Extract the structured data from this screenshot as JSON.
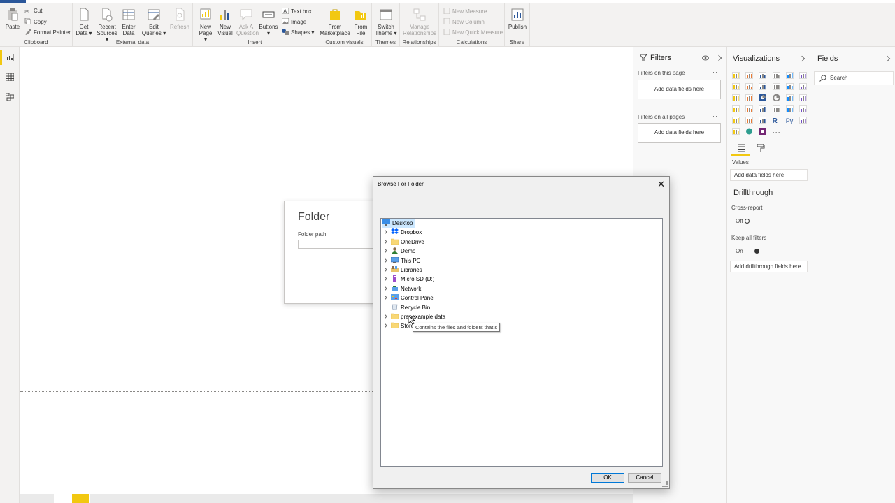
{
  "ribbon": {
    "clipboard": {
      "label": "Clipboard",
      "paste": "Paste",
      "cut": "Cut",
      "copy": "Copy",
      "format_painter": "Format Painter"
    },
    "external_data": {
      "label": "External data",
      "get_data": "Get Data",
      "recent_sources": "Recent Sources",
      "enter_data": "Enter Data",
      "edit_queries": "Edit Queries",
      "refresh": "Refresh"
    },
    "insert": {
      "label": "Insert",
      "new_page": "New Page",
      "new_visual": "New Visual",
      "ask_question": "Ask A Question",
      "buttons": "Buttons",
      "text_box": "Text box",
      "image": "Image",
      "shapes": "Shapes"
    },
    "custom_visuals": {
      "label": "Custom visuals",
      "from_marketplace": "From Marketplace",
      "from_file": "From File"
    },
    "themes": {
      "label": "Themes",
      "switch_theme": "Switch Theme"
    },
    "relationships": {
      "label": "Relationships",
      "manage": "Manage Relationships"
    },
    "calculations": {
      "label": "Calculations",
      "new_measure": "New Measure",
      "new_column": "New Column",
      "new_quick_measure": "New Quick Measure"
    },
    "share": {
      "label": "Share",
      "publish": "Publish"
    }
  },
  "folder_dialog": {
    "title": "Folder",
    "path_label": "Folder path"
  },
  "filters": {
    "title": "Filters",
    "on_this_page": "Filters on this page",
    "on_all_pages": "Filters on all pages",
    "drop_hint": "Add data fields here"
  },
  "visualizations": {
    "title": "Visualizations",
    "values_label": "Values",
    "values_hint": "Add data fields here",
    "drillthrough_title": "Drillthrough",
    "cross_report": "Cross-report",
    "cross_report_state": "Off",
    "keep_all_filters": "Keep all filters",
    "keep_all_filters_state": "On",
    "drillthrough_hint": "Add drillthrough fields here",
    "r_label": "R",
    "py_label": "Py"
  },
  "fields": {
    "title": "Fields",
    "search_placeholder": "Search"
  },
  "browse_dialog": {
    "title": "Browse For Folder",
    "tree": [
      {
        "label": "Desktop",
        "icon": "desktop-icon",
        "expandable": false,
        "selected": true
      },
      {
        "label": "Dropbox",
        "icon": "dropbox-icon",
        "expandable": true
      },
      {
        "label": "OneDrive",
        "icon": "folder-icon",
        "expandable": true
      },
      {
        "label": "Demo",
        "icon": "user-icon",
        "expandable": true
      },
      {
        "label": "This PC",
        "icon": "computer-icon",
        "expandable": true
      },
      {
        "label": "Libraries",
        "icon": "libraries-icon",
        "expandable": true
      },
      {
        "label": "Micro SD (D:)",
        "icon": "usb-drive-icon",
        "expandable": true
      },
      {
        "label": "Network",
        "icon": "network-icon",
        "expandable": true
      },
      {
        "label": "Control Panel",
        "icon": "control-panel-icon",
        "expandable": true
      },
      {
        "label": "Recycle Bin",
        "icon": "recycle-bin-icon",
        "expandable": false
      },
      {
        "label": "prepexample data",
        "icon": "folder-icon",
        "expandable": true
      },
      {
        "label": "Store",
        "icon": "folder-icon",
        "expandable": true
      }
    ],
    "tooltip": "Contains the files and folders that s",
    "ok": "OK",
    "cancel": "Cancel"
  },
  "colors": {
    "accent": "#f2c811",
    "file_tab": "#2b579a",
    "selection": "#cce8ff",
    "ribbon_bg": "#f3f2f1"
  }
}
